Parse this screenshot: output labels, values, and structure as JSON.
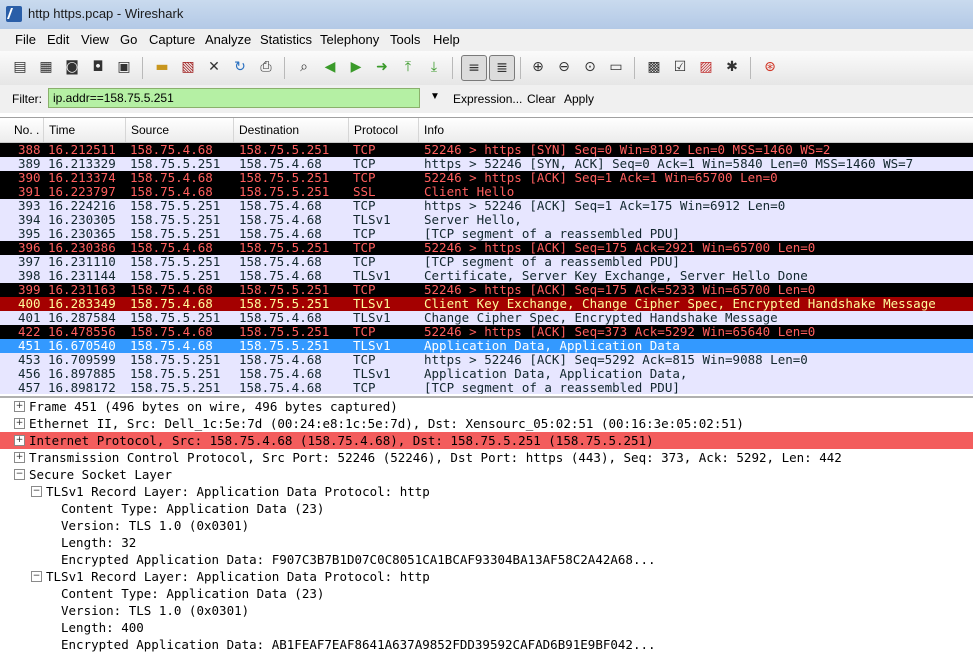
{
  "window": {
    "title": "http https.pcap - Wireshark"
  },
  "menu": [
    "File",
    "Edit",
    "View",
    "Go",
    "Capture",
    "Analyze",
    "Statistics",
    "Telephony",
    "Tools",
    "Help"
  ],
  "toolbar_icons": [
    "interface-list-icon",
    "capture-options-icon",
    "capture-start-icon",
    "capture-stop-icon",
    "capture-restart-icon",
    "open-icon",
    "save-icon",
    "close-icon",
    "reload-icon",
    "print-icon",
    "find-icon",
    "back-icon",
    "forward-icon",
    "goto-icon",
    "first-packet-icon",
    "last-packet-icon",
    "colorize-icon",
    "autoscroll-icon",
    "zoom-in-icon",
    "zoom-out-icon",
    "zoom-normal-icon",
    "resize-columns-icon",
    "capture-filters-icon",
    "display-filters-icon",
    "coloring-rules-icon",
    "preferences-icon",
    "help-icon"
  ],
  "filter": {
    "label": "Filter:",
    "value": "ip.addr==158.75.5.251",
    "expression": "Expression...",
    "clear": "Clear",
    "apply": "Apply"
  },
  "columns": [
    "No. .",
    "Time",
    "Source",
    "Destination",
    "Protocol",
    "Info"
  ],
  "packets": [
    {
      "no": "388",
      "time": "16.212511",
      "src": "158.75.4.68",
      "dst": "158.75.5.251",
      "proto": "TCP",
      "info": "52246 > https [SYN] Seq=0 Win=8192 Len=0 MSS=1460 WS=2",
      "style": "blk"
    },
    {
      "no": "389",
      "time": "16.213329",
      "src": "158.75.5.251",
      "dst": "158.75.4.68",
      "proto": "TCP",
      "info": "https > 52246 [SYN, ACK] Seq=0 Ack=1 Win=5840 Len=0 MSS=1460 WS=7",
      "style": "lav"
    },
    {
      "no": "390",
      "time": "16.213374",
      "src": "158.75.4.68",
      "dst": "158.75.5.251",
      "proto": "TCP",
      "info": "52246 > https [ACK] Seq=1 Ack=1 Win=65700 Len=0",
      "style": "blk"
    },
    {
      "no": "391",
      "time": "16.223797",
      "src": "158.75.4.68",
      "dst": "158.75.5.251",
      "proto": "SSL",
      "info": "Client Hello",
      "style": "blk"
    },
    {
      "no": "393",
      "time": "16.224216",
      "src": "158.75.5.251",
      "dst": "158.75.4.68",
      "proto": "TCP",
      "info": "https > 52246 [ACK] Seq=1 Ack=175 Win=6912 Len=0",
      "style": "lav"
    },
    {
      "no": "394",
      "time": "16.230305",
      "src": "158.75.5.251",
      "dst": "158.75.4.68",
      "proto": "TLSv1",
      "info": "Server Hello,",
      "style": "lav"
    },
    {
      "no": "395",
      "time": "16.230365",
      "src": "158.75.5.251",
      "dst": "158.75.4.68",
      "proto": "TCP",
      "info": "[TCP segment of a reassembled PDU]",
      "style": "lav"
    },
    {
      "no": "396",
      "time": "16.230386",
      "src": "158.75.4.68",
      "dst": "158.75.5.251",
      "proto": "TCP",
      "info": "52246 > https [ACK] Seq=175 Ack=2921 Win=65700 Len=0",
      "style": "blk"
    },
    {
      "no": "397",
      "time": "16.231110",
      "src": "158.75.5.251",
      "dst": "158.75.4.68",
      "proto": "TCP",
      "info": "[TCP segment of a reassembled PDU]",
      "style": "lav"
    },
    {
      "no": "398",
      "time": "16.231144",
      "src": "158.75.5.251",
      "dst": "158.75.4.68",
      "proto": "TLSv1",
      "info": "Certificate, Server Key Exchange, Server Hello Done",
      "style": "lav"
    },
    {
      "no": "399",
      "time": "16.231163",
      "src": "158.75.4.68",
      "dst": "158.75.5.251",
      "proto": "TCP",
      "info": "52246 > https [ACK] Seq=175 Ack=5233 Win=65700 Len=0",
      "style": "blk"
    },
    {
      "no": "400",
      "time": "16.283349",
      "src": "158.75.4.68",
      "dst": "158.75.5.251",
      "proto": "TLSv1",
      "info": "Client Key Exchange, Change Cipher Spec, Encrypted Handshake Message",
      "style": "red"
    },
    {
      "no": "401",
      "time": "16.287584",
      "src": "158.75.5.251",
      "dst": "158.75.4.68",
      "proto": "TLSv1",
      "info": "Change Cipher Spec, Encrypted Handshake Message",
      "style": "lav"
    },
    {
      "no": "422",
      "time": "16.478556",
      "src": "158.75.4.68",
      "dst": "158.75.5.251",
      "proto": "TCP",
      "info": "52246 > https [ACK] Seq=373 Ack=5292 Win=65640 Len=0",
      "style": "blk"
    },
    {
      "no": "451",
      "time": "16.670540",
      "src": "158.75.4.68",
      "dst": "158.75.5.251",
      "proto": "TLSv1",
      "info": "Application Data, Application Data",
      "style": "sel"
    },
    {
      "no": "453",
      "time": "16.709599",
      "src": "158.75.5.251",
      "dst": "158.75.4.68",
      "proto": "TCP",
      "info": "https > 52246 [ACK] Seq=5292 Ack=815 Win=9088 Len=0",
      "style": "lav"
    },
    {
      "no": "456",
      "time": "16.897885",
      "src": "158.75.5.251",
      "dst": "158.75.4.68",
      "proto": "TLSv1",
      "info": "Application Data, Application Data,",
      "style": "lav"
    },
    {
      "no": "457",
      "time": "16.898172",
      "src": "158.75.5.251",
      "dst": "158.75.4.68",
      "proto": "TCP",
      "info": "[TCP segment of a reassembled PDU]",
      "style": "lav"
    }
  ],
  "details": [
    {
      "level": 0,
      "toggle": "+",
      "text": "Frame 451 (496 bytes on wire, 496 bytes captured)",
      "hl": false
    },
    {
      "level": 0,
      "toggle": "+",
      "text": "Ethernet II, Src: Dell_1c:5e:7d (00:24:e8:1c:5e:7d), Dst: Xensourc_05:02:51 (00:16:3e:05:02:51)",
      "hl": false
    },
    {
      "level": 0,
      "toggle": "+",
      "text": "Internet Protocol, Src: 158.75.4.68 (158.75.4.68), Dst: 158.75.5.251 (158.75.5.251)",
      "hl": true
    },
    {
      "level": 0,
      "toggle": "+",
      "text": "Transmission Control Protocol, Src Port: 52246 (52246), Dst Port: https (443), Seq: 373, Ack: 5292, Len: 442",
      "hl": false
    },
    {
      "level": 0,
      "toggle": "-",
      "text": "Secure Socket Layer",
      "hl": false
    },
    {
      "level": 1,
      "toggle": "-",
      "text": "TLSv1 Record Layer: Application Data Protocol: http",
      "hl": false
    },
    {
      "level": 2,
      "toggle": "",
      "text": "Content Type: Application Data (23)",
      "hl": false
    },
    {
      "level": 2,
      "toggle": "",
      "text": "Version: TLS 1.0 (0x0301)",
      "hl": false
    },
    {
      "level": 2,
      "toggle": "",
      "text": "Length: 32",
      "hl": false
    },
    {
      "level": 2,
      "toggle": "",
      "text": "Encrypted Application Data: F907C3B7B1D07C0C8051CA1BCAF93304BA13AF58C2A42A68...",
      "hl": false
    },
    {
      "level": 1,
      "toggle": "-",
      "text": "TLSv1 Record Layer: Application Data Protocol: http",
      "hl": false
    },
    {
      "level": 2,
      "toggle": "",
      "text": "Content Type: Application Data (23)",
      "hl": false
    },
    {
      "level": 2,
      "toggle": "",
      "text": "Version: TLS 1.0 (0x0301)",
      "hl": false
    },
    {
      "level": 2,
      "toggle": "",
      "text": "Length: 400",
      "hl": false
    },
    {
      "level": 2,
      "toggle": "",
      "text": "Encrypted Application Data: AB1FEAF7EAF8641A637A9852FDD39592CAFAD6B91E9BF042...",
      "hl": false
    }
  ]
}
